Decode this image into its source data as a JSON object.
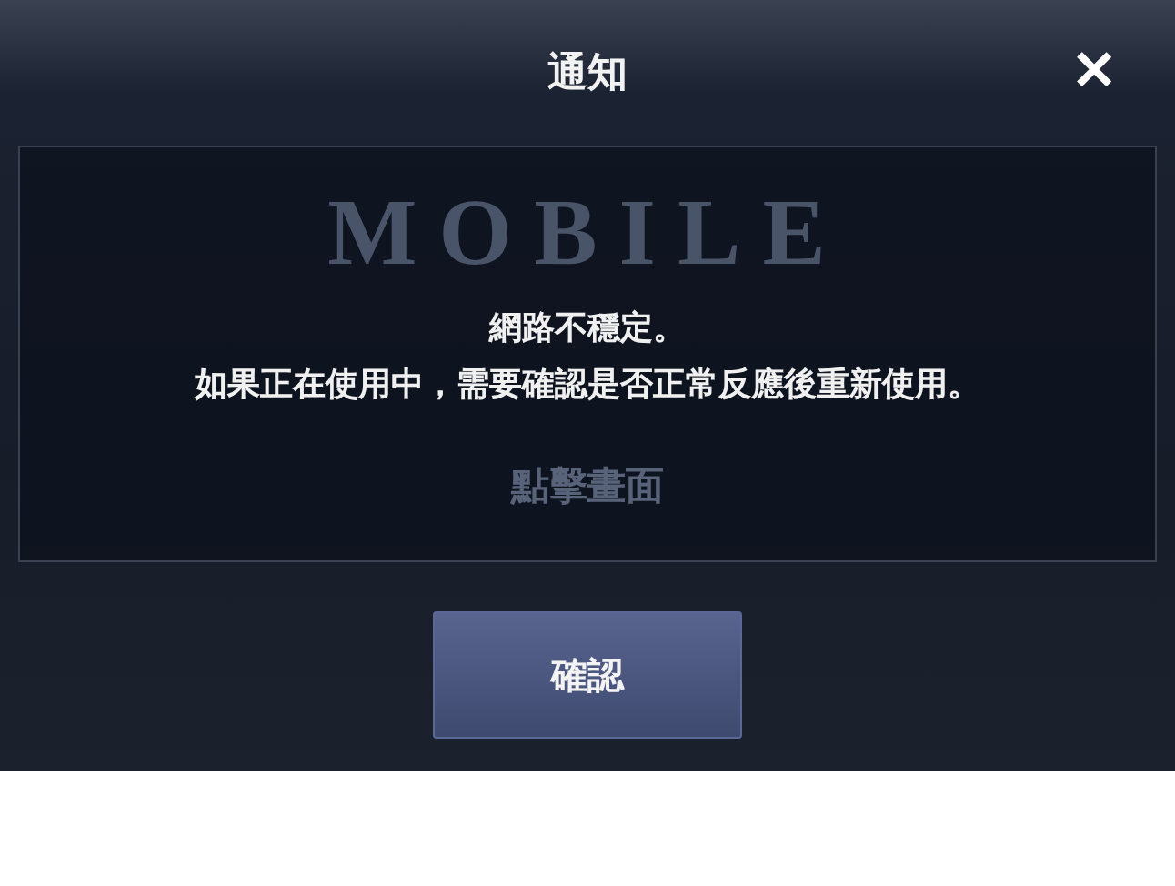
{
  "dialog": {
    "title": "通知",
    "close": "✕",
    "message": [
      "網路不穩定。",
      "如果正在使用中，需要確認是否正常反應後重新使用。"
    ],
    "button": "確認"
  },
  "background": {
    "logo": "MOBILE",
    "hint": "點擊畫面"
  }
}
